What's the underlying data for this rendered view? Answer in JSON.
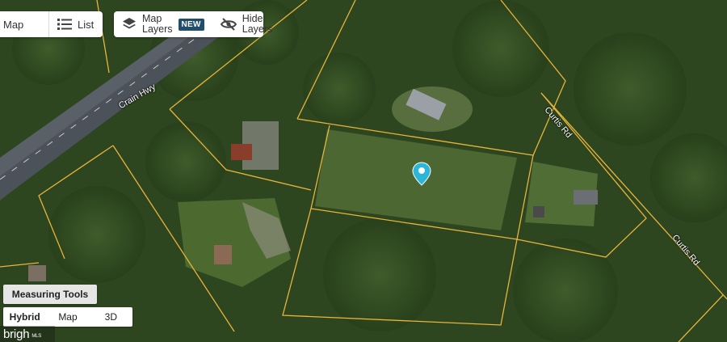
{
  "toolbar": {
    "map_label": "Map",
    "list_label": "List",
    "layers_line1": "Map",
    "layers_line2": "Layers",
    "new_badge": "NEW",
    "hide_line1": "Hide",
    "hide_line2": "Layers"
  },
  "map": {
    "roads": [
      "Crain Hwy",
      "Curtis Rd",
      "Curtis Rd"
    ],
    "pin_color": "#2bb5d8",
    "parcel_line_color": "#e8b43a"
  },
  "controls": {
    "measuring_tools_label": "Measuring Tools",
    "map_types": [
      "Hybrid",
      "Map",
      "3D"
    ],
    "active_map_type": "Hybrid"
  },
  "brand": {
    "logo_text": "brigh",
    "trademark": "MLS"
  },
  "icons": {
    "list": "list-icon",
    "layers": "layers-icon",
    "hide_layers": "eye-off-icon",
    "pin": "map-pin-icon"
  }
}
